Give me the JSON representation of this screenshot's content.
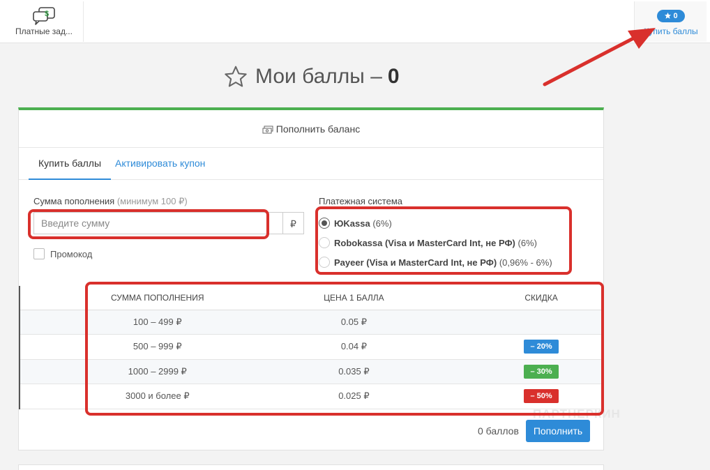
{
  "topbar": {
    "tasks_label": "Платные зад...",
    "tasks_icon": "chat-dollar-icon",
    "buy_badge": "0",
    "buy_label": "Купить баллы",
    "accent_color": "#2e8bd8"
  },
  "page": {
    "title": "Мои баллы –",
    "points": "0"
  },
  "panel": {
    "header": "Пополнить баланс",
    "accent_color": "#4caf50",
    "tabs": [
      {
        "label": "Купить баллы",
        "active": true
      },
      {
        "label": "Активировать купон",
        "active": false
      }
    ],
    "amount": {
      "label": "Сумма пополнения",
      "hint": "(минимум 100 ₽)",
      "placeholder": "Введите сумму",
      "currency": "₽"
    },
    "promo_label": "Промокод",
    "payment": {
      "label": "Платежная система",
      "options": [
        {
          "name": "ЮKassa",
          "fee": "(6%)",
          "selected": true
        },
        {
          "name": "Robokassa (Visa и MasterCard Int, не РФ)",
          "fee": "(6%)",
          "selected": false
        },
        {
          "name": "Payeer (Visa и MasterCard Int, не РФ)",
          "fee": "(0,96% - 6%)",
          "selected": false
        }
      ]
    },
    "table": {
      "headers": [
        "Сумма пополнения",
        "Цена 1 балла",
        "Скидка"
      ],
      "rows": [
        {
          "amount": "100 – 499 ₽",
          "price": "0.05 ₽",
          "discount": "",
          "color": ""
        },
        {
          "amount": "500 – 999 ₽",
          "price": "0.04 ₽",
          "discount": "– 20%",
          "color": "#2e8bd8"
        },
        {
          "amount": "1000 – 2999 ₽",
          "price": "0.035 ₽",
          "discount": "– 30%",
          "color": "#4caf50"
        },
        {
          "amount": "3000 и более ₽",
          "price": "0.025 ₽",
          "discount": "– 50%",
          "color": "#d9302c"
        }
      ]
    },
    "footer": {
      "count": "0 баллов",
      "button": "Пополнить"
    }
  },
  "watermark": "ПАРТНЕРКИН",
  "annotation_color": "#d9302c"
}
